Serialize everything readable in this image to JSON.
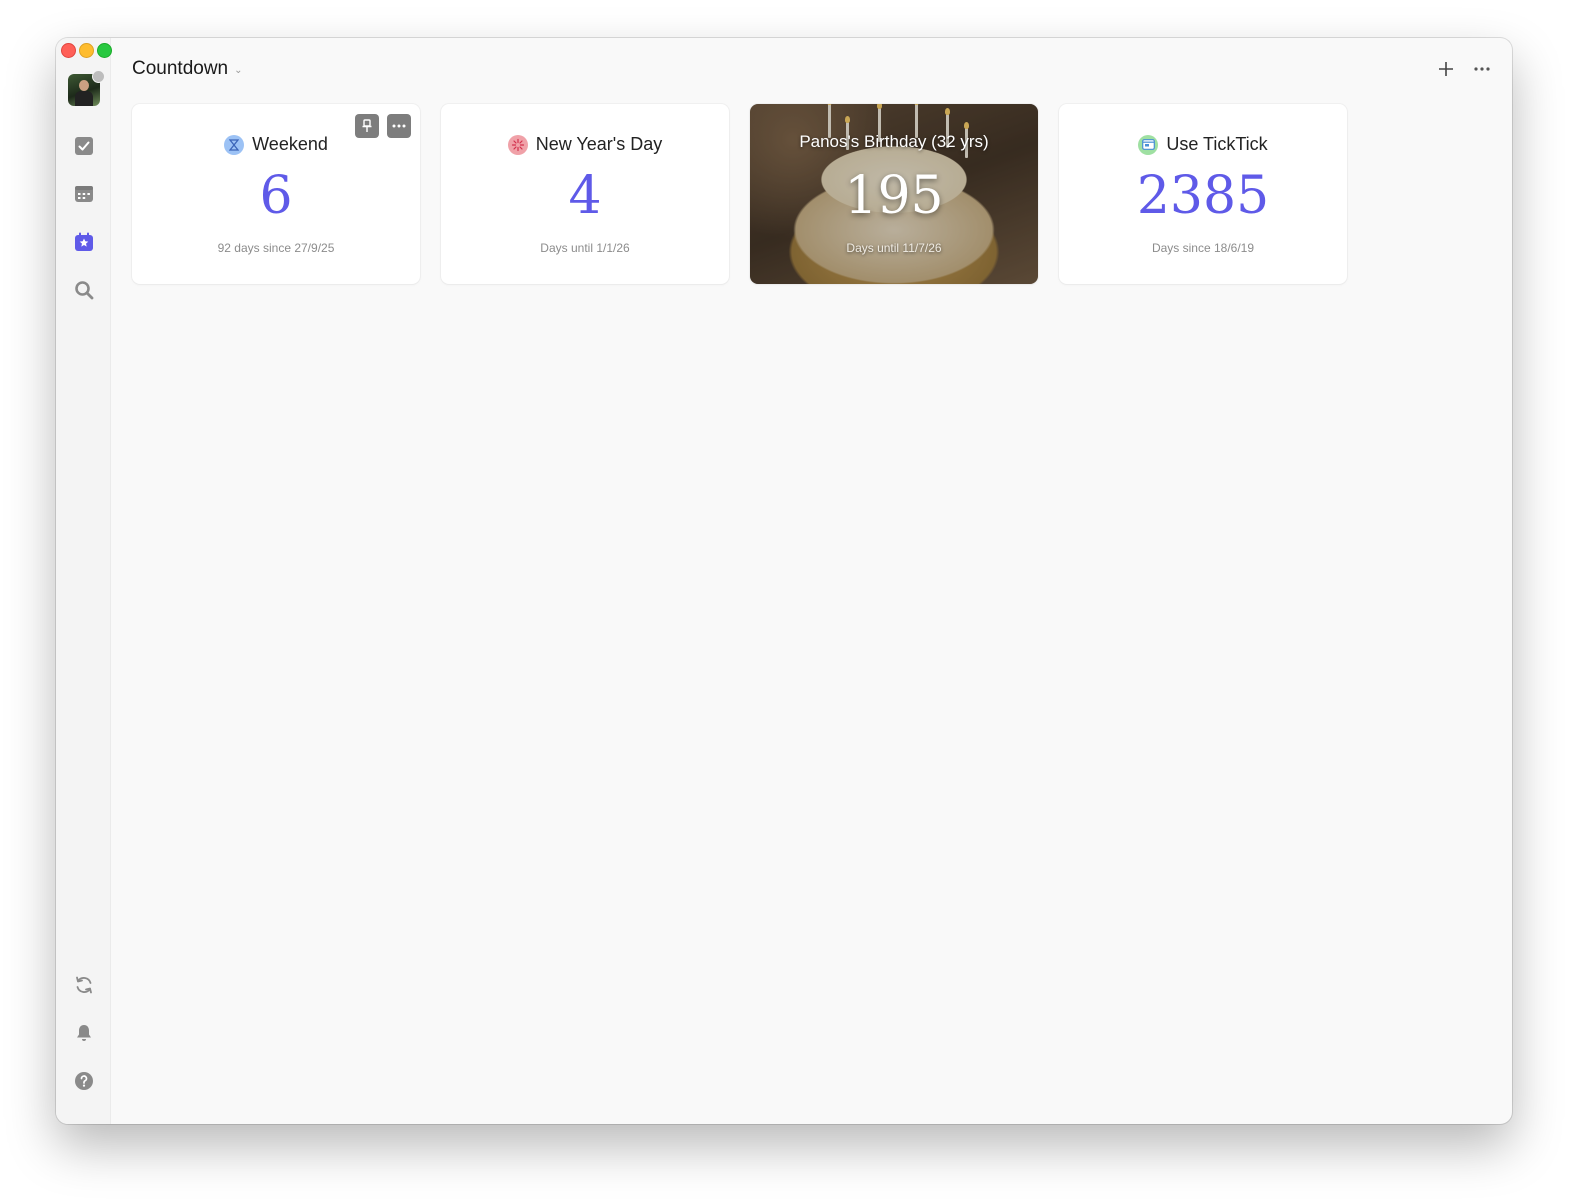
{
  "header": {
    "title": "Countdown"
  },
  "colors": {
    "accent": "#5f5ae8",
    "sidebar_active": "#5f5ae8",
    "icon": "#808080"
  },
  "sidebar": {
    "top_icons": [
      "task-icon",
      "calendar-icon",
      "countdown-icon",
      "search-icon"
    ],
    "bottom_icons": [
      "sync-icon",
      "bell-icon",
      "help-icon"
    ]
  },
  "cards": [
    {
      "title": "Weekend",
      "number": "6",
      "subtitle": "92 days since 27/9/25",
      "icon": "hourglass-icon"
    },
    {
      "title": "New Year's Day",
      "number": "4",
      "subtitle": "Days until 1/1/26",
      "icon": "fireworks-icon"
    },
    {
      "title": "Panos's Birthday (32 yrs)",
      "number": "195",
      "subtitle": "Days until 11/7/26",
      "icon": "birthday-cake-photo"
    },
    {
      "title": "Use TickTick",
      "number": "2385",
      "subtitle": "Days since 18/6/19",
      "icon": "app-window-icon"
    }
  ]
}
